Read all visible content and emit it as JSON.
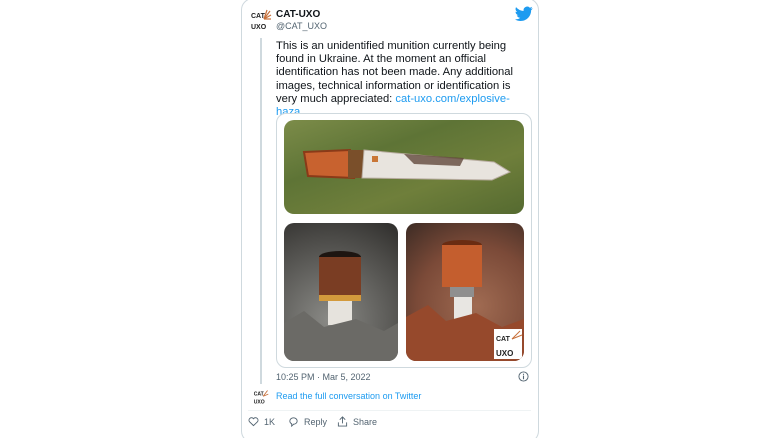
{
  "tweet": {
    "author_name": "CAT-UXO",
    "author_handle": "@CAT_UXO",
    "logo_text": [
      "CAT",
      "UXO"
    ],
    "text": "This is an unidentified munition currently being found in Ukraine. At the moment an official identification has not been made. Any additional images, technical information or identification is very much appreciated: ",
    "link_text": "cat-uxo.com/explosive-haza…",
    "timestamp": "10:25 PM · Mar 5, 2022",
    "conversation_link": "Read the full conversation on Twitter"
  },
  "actions": {
    "like_count": "1K",
    "reply_label": "Reply",
    "share_label": "Share"
  },
  "colors": {
    "link": "#1d9bf0",
    "muted": "#536471",
    "border": "#cfd9de",
    "logo_accent": "#c8703a"
  },
  "icons": [
    "twitter-bird-icon",
    "info-icon",
    "heart-icon",
    "reply-icon",
    "share-icon"
  ]
}
